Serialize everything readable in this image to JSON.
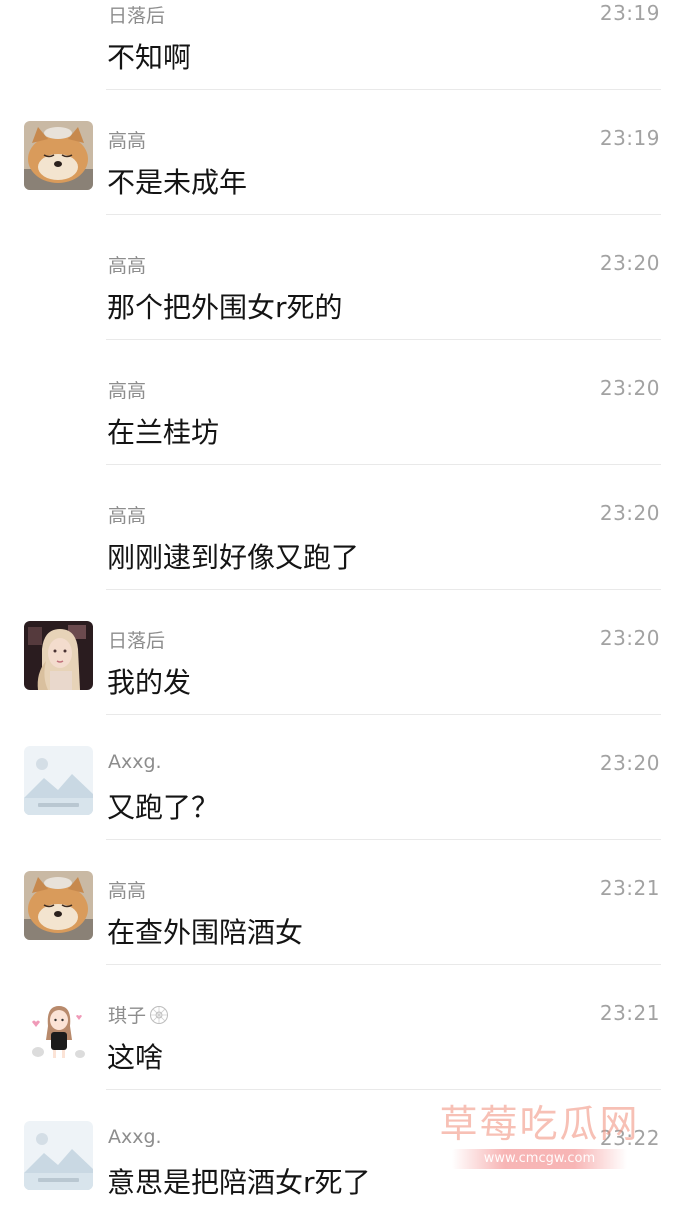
{
  "messages": [
    {
      "name": "日落后",
      "time": "23:19",
      "text": "不知啊",
      "avatar": "none"
    },
    {
      "name": "高高",
      "time": "23:19",
      "text": "不是未成年",
      "avatar": "shiba-dog"
    },
    {
      "name": "高高",
      "time": "23:20",
      "text": "那个把外围女r死的",
      "avatar": "none"
    },
    {
      "name": "高高",
      "time": "23:20",
      "text": "在兰桂坊",
      "avatar": "none"
    },
    {
      "name": "高高",
      "time": "23:20",
      "text": "刚刚逮到好像又跑了",
      "avatar": "none"
    },
    {
      "name": "日落后",
      "time": "23:20",
      "text": "我的发",
      "avatar": "blonde-girl-photo"
    },
    {
      "name": "Axxg.",
      "time": "23:20",
      "text": "又跑了？",
      "avatar": "placeholder-landscape"
    },
    {
      "name": "高高",
      "time": "23:21",
      "text": "在查外围陪酒女",
      "avatar": "shiba-dog"
    },
    {
      "name": "琪子",
      "time": "23:21",
      "text": "这啥",
      "avatar": "cartoon-girl",
      "badge": "spiral-badge-icon"
    },
    {
      "name": "Axxg.",
      "time": "23:22",
      "text": "意思是把陪酒女r死了",
      "avatar": "placeholder-landscape"
    }
  ],
  "watermark": {
    "title": "草莓吃瓜网",
    "url": "www.cmcgw.com"
  }
}
